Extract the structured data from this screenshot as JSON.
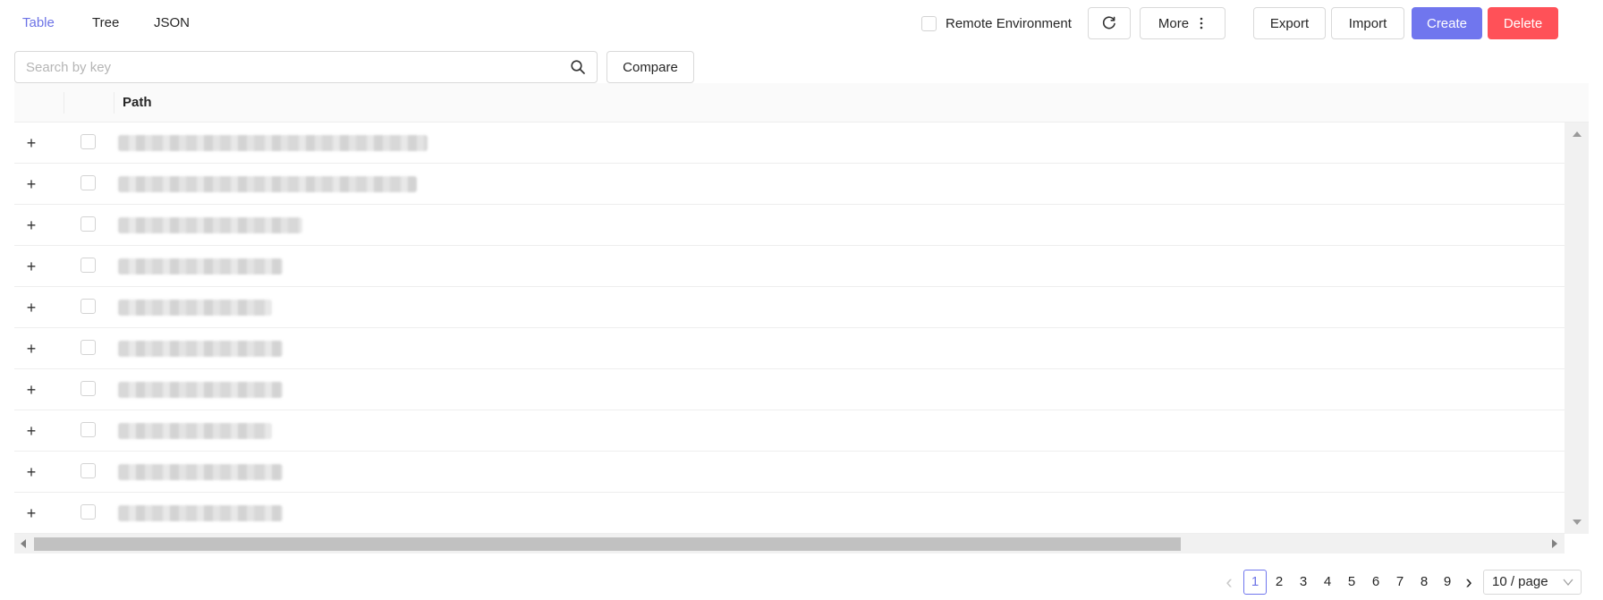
{
  "tabs": [
    {
      "label": "Table",
      "active": true
    },
    {
      "label": "Tree",
      "active": false
    },
    {
      "label": "JSON",
      "active": false
    }
  ],
  "toolbar": {
    "remote_label": "Remote Environment",
    "refresh_icon": "refresh-icon",
    "more_label": "More",
    "more_icon": "vertical-ellipsis-icon",
    "export_label": "Export",
    "import_label": "Import",
    "create_label": "Create",
    "delete_label": "Delete"
  },
  "search": {
    "placeholder": "Search by key",
    "value": "",
    "icon": "search-icon",
    "compare_label": "Compare"
  },
  "table": {
    "columns": [
      "",
      "",
      "Path"
    ],
    "row_count_visible": 10,
    "expand_glyph": "+"
  },
  "pagination": {
    "prev_glyph": "‹",
    "next_glyph": "›",
    "pages": [
      "1",
      "2",
      "3",
      "4",
      "5",
      "6",
      "7",
      "8",
      "9"
    ],
    "current": "1",
    "page_size": "10 / page"
  },
  "colors": {
    "accent": "#6c73e6",
    "primary_button": "#7076ee",
    "danger_button": "#ff5158"
  }
}
